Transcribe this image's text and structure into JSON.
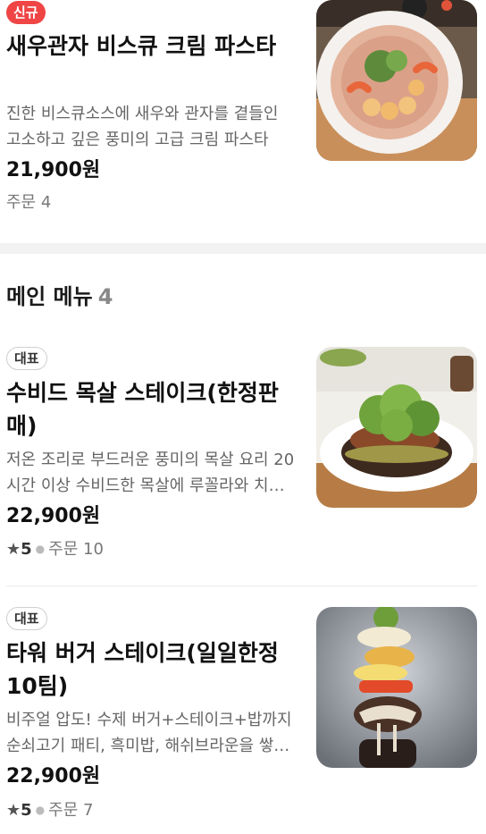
{
  "featured": {
    "badge": "신규",
    "title": "새우관자 비스큐 크림 파스타",
    "description": "진한 비스큐소스에 새우와 관자를 곁들인 고소하고 깊은 풍미의 고급 크림 파스타",
    "price": "21,900원",
    "orders": "주문 4",
    "image_icon": "pasta-dish-image"
  },
  "section": {
    "title": "메인 메뉴",
    "count": "4"
  },
  "items": [
    {
      "badge": "대표",
      "title": "수비드 목살 스테이크(한정판매)",
      "description": "저온 조리로 부드러운 풍미의 목살 요리 20시간 이상 수비드한 목살에 루꼴라와 치즈를 곁들인 스테이크",
      "price": "22,900원",
      "rating": "5",
      "orders": "주문 10",
      "image_icon": "steak-dish-image"
    },
    {
      "badge": "대표",
      "title": "타워 버거 스테이크(일일한정10팀)",
      "description": "비주얼 압도! 수제 버거+스테이크+밥까지 순쇠고기 패티, 흑미밥, 해쉬브라운을 쌓아올린 타워",
      "price": "22,900원",
      "rating": "5",
      "orders": "주문 7",
      "image_icon": "tower-burger-image"
    }
  ],
  "colors": {
    "new_badge": "#ef4545",
    "section_gap": "#f2f2f2"
  }
}
